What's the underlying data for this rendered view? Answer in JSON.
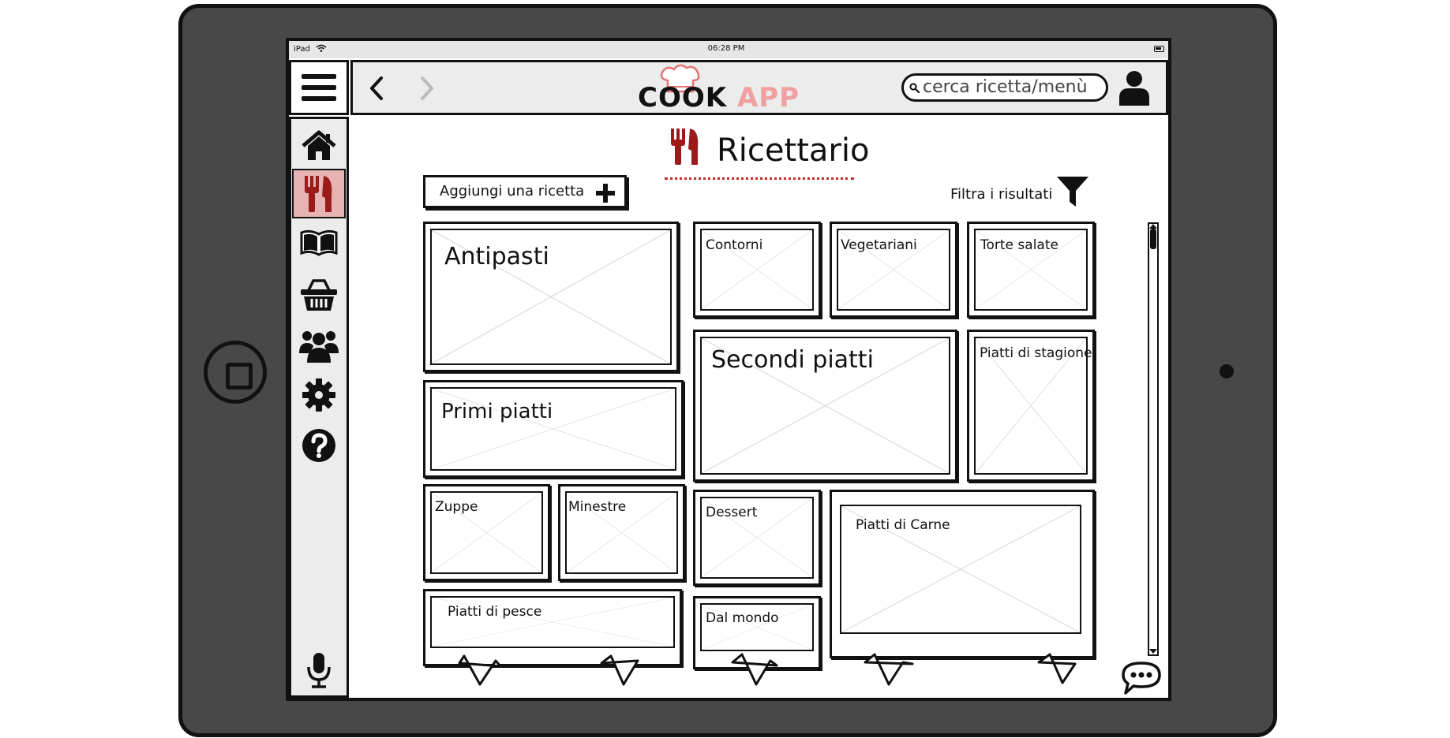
{
  "status_bar": {
    "device": "iPad",
    "time": "06:28 PM"
  },
  "app": {
    "logo_word1": "COOK",
    "logo_word2": "APP"
  },
  "search": {
    "placeholder": "cerca ricetta/menù"
  },
  "page": {
    "title": "Ricettario"
  },
  "toolbar": {
    "add_recipe_label": "Aggiungi una ricetta",
    "filter_label": "Filtra i risultati"
  },
  "categories": {
    "antipasti": "Antipasti",
    "contorni": "Contorni",
    "vegetariani": "Vegetariani",
    "torte_salate": "Torte salate",
    "primi_piatti": "Primi piatti",
    "secondi_piatti": "Secondi piatti",
    "piatti_di_stagione": "Piatti di stagione",
    "zuppe": "Zuppe",
    "minestre": "Minestre",
    "dessert": "Dessert",
    "piatti_di_carne": "Piatti di Carne",
    "piatti_di_pesce": "Piatti di pesce",
    "dal_mondo": "Dal mondo"
  },
  "sidebar": {
    "items": [
      "home-icon",
      "cutlery-icon",
      "book-icon",
      "basket-icon",
      "group-icon",
      "gear-icon",
      "help-icon"
    ],
    "active": "cutlery-icon"
  },
  "colors": {
    "accent": "#b71c1c",
    "active_bg": "#e8b3b3",
    "logo_app": "#f0a0a0",
    "device": "#484848"
  }
}
